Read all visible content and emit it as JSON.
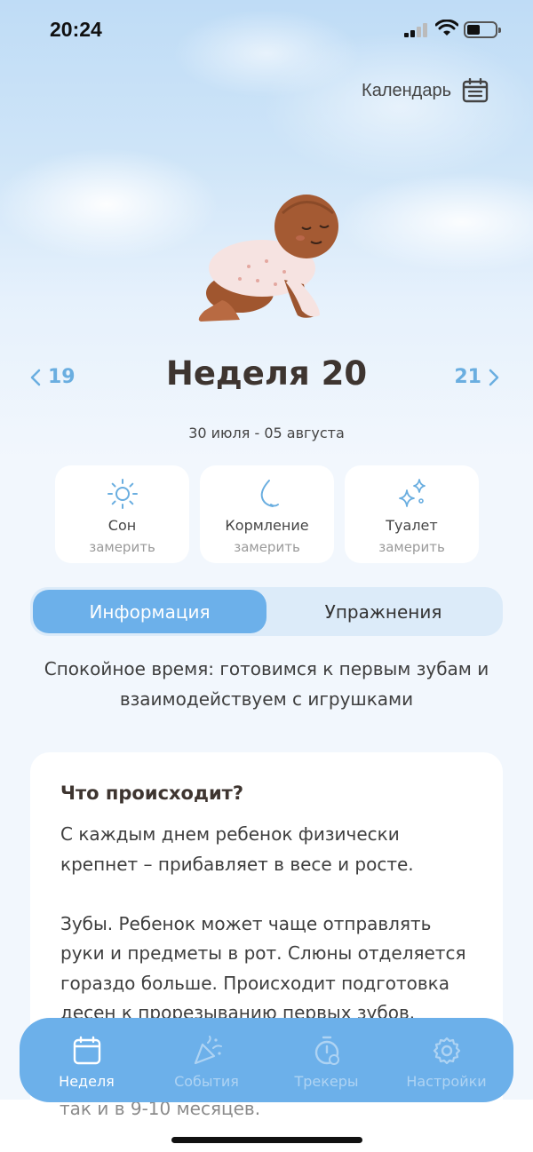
{
  "status_bar": {
    "time": "20:24"
  },
  "header": {
    "calendar_label": "Календарь"
  },
  "week_nav": {
    "prev": "19",
    "title": "Неделя 20",
    "next": "21",
    "dates": "30 июля - 05 августа"
  },
  "trackers": [
    {
      "name": "Сон",
      "action": "замерить",
      "icon": "sun-icon"
    },
    {
      "name": "Кормление",
      "action": "замерить",
      "icon": "feeding-icon"
    },
    {
      "name": "Туалет",
      "action": "замерить",
      "icon": "sparkles-icon"
    }
  ],
  "segments": {
    "active": "Информация",
    "inactive": "Упражнения"
  },
  "subtitle": "Спокойное время: готовимся к первым зубам и взаимодействуем с игрушками",
  "card": {
    "heading": "Что происходит?",
    "body": "С каждым днем ребенок физически крепнет – прибавляет в весе и росте.\n\nЗубы. Ребенок может чаще отправлять руки и предметы в рот. Слюны отделяется гораздо больше. Происходит подготовка десен к прорезыванию первых зубов.",
    "tail": "так и в 9-10 месяцев."
  },
  "tab_bar": [
    {
      "label": "Неделя",
      "icon": "calendar-icon",
      "active": true
    },
    {
      "label": "События",
      "icon": "party-popper-icon",
      "active": false
    },
    {
      "label": "Трекеры",
      "icon": "stopwatch-icon",
      "active": false
    },
    {
      "label": "Настройки",
      "icon": "gear-icon",
      "active": false
    }
  ],
  "colors": {
    "accent": "#6cb0ea",
    "title": "#3e3530",
    "background": "#f2f7fd"
  }
}
